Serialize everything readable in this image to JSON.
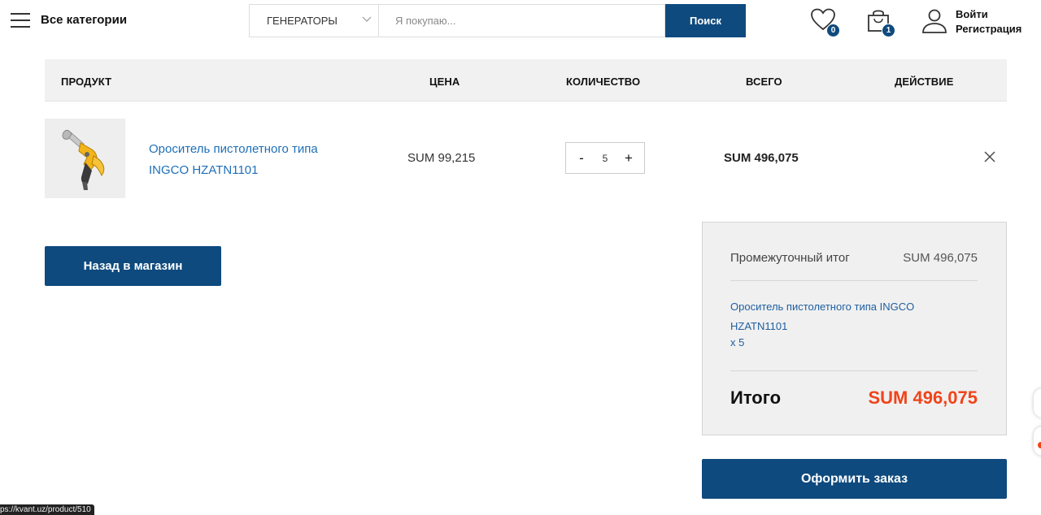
{
  "header": {
    "all_categories": "Все категории",
    "category_selected": "ГЕНЕРАТОРЫ",
    "search_placeholder": "Я покупаю...",
    "search_button": "Поиск",
    "wishlist_count": "0",
    "cart_count": "1",
    "login": "Войти",
    "register": "Регистрация"
  },
  "table": {
    "columns": {
      "product": "ПРОДУКТ",
      "price": "ЦЕНА",
      "quantity": "КОЛИЧЕСТВО",
      "total": "ВСЕГО",
      "action": "ДЕЙСТВИЕ"
    },
    "rows": [
      {
        "name": "Ороситель пистолетного типа INGCO HZATN1101",
        "price": "SUM 99,215",
        "quantity": "5",
        "total": "SUM 496,075"
      }
    ]
  },
  "back_button": "Назад в магазин",
  "summary": {
    "subtotal_label": "Промежуточный итог",
    "subtotal_value": "SUM 496,075",
    "item_name": "Ороситель пистолетного типа INGCO HZATN1101",
    "item_qty": "x 5",
    "total_label": "Итого",
    "total_value": "SUM 496,075"
  },
  "order_button": "Оформить заказ",
  "status_url": "ps://kvant.uz/product/510",
  "colors": {
    "brand_blue": "#0e4a7e",
    "link_blue": "#1e6fb8",
    "total_red": "#f0441a"
  },
  "icons": [
    "menu-icon",
    "chevron-down-icon",
    "heart-icon",
    "shopping-bag-icon",
    "user-icon",
    "close-icon"
  ]
}
